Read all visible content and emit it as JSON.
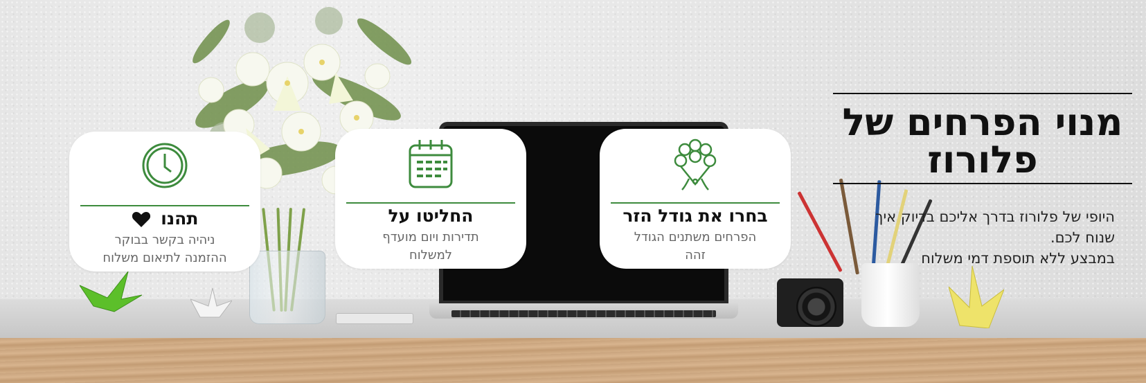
{
  "hero": {
    "headline_line1": "מנוי הפרחים של",
    "headline_line2": "פלורוז",
    "description_line1": "היופי של פלורוז בדרך אליכם בדיוק איך",
    "description_line2": "שנוח לכם.",
    "description_line3": "במבצע ללא תוספת דמי משלוח"
  },
  "cards": [
    {
      "icon": "bouquet-icon",
      "title": "בחרו את גודל הזר",
      "sub_line1": "הפרחים משתנים הגודל",
      "sub_line2": "זהה"
    },
    {
      "icon": "calendar-icon",
      "title": "החליטו על",
      "sub_line1": "תדירות ויום מועדף",
      "sub_line2": "למשלוח"
    },
    {
      "icon": "clock-icon",
      "title": "תהנו",
      "title_icon": "heart-icon",
      "sub_line1": "ניהיה בקשר בבוקר",
      "sub_line2": "ההזמנה לתיאום משלוח"
    }
  ],
  "colors": {
    "accent_green": "#3d8b3d",
    "text_dark": "#111111",
    "text_muted": "#666666",
    "card_bg": "#ffffff"
  }
}
